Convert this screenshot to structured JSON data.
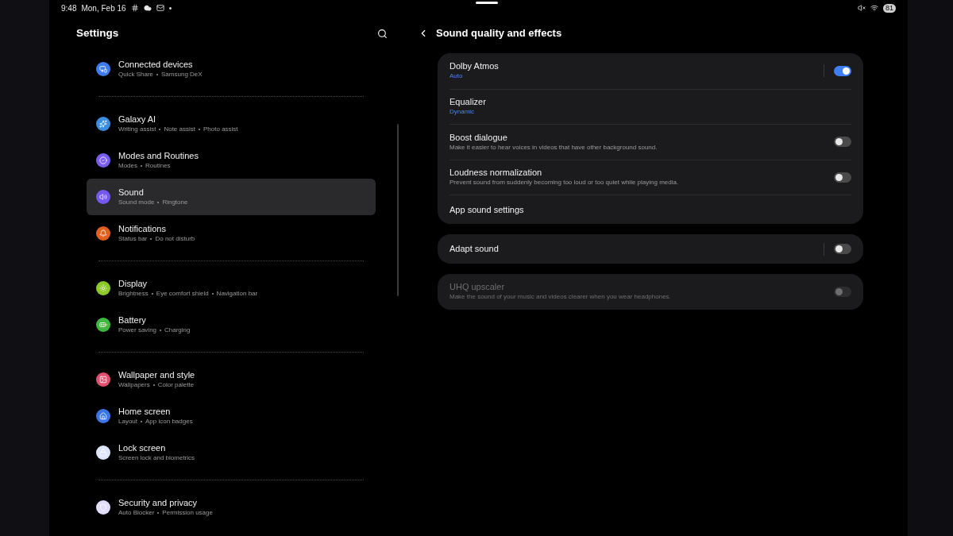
{
  "status_bar": {
    "time": "9:48",
    "date": "Mon, Feb 16",
    "dot": "•",
    "battery": "81"
  },
  "sidebar": {
    "title": "Settings",
    "groups": [
      [
        {
          "title": "Connected devices",
          "details": [
            "Quick Share",
            "Samsung DeX"
          ],
          "color": "#3f7bf0",
          "selected": false
        }
      ],
      [
        {
          "title": "Galaxy AI",
          "details": [
            "Writing assist",
            "Note assist",
            "Photo assist"
          ],
          "color": "#3a8de0",
          "selected": false
        },
        {
          "title": "Modes and Routines",
          "details": [
            "Modes",
            "Routines"
          ],
          "color": "#7b5cf0",
          "selected": false
        },
        {
          "title": "Sound",
          "details": [
            "Sound mode",
            "Ringtone"
          ],
          "color": "#7559ee",
          "selected": true
        },
        {
          "title": "Notifications",
          "details": [
            "Status bar",
            "Do not disturb"
          ],
          "color": "#e2601f",
          "selected": false
        }
      ],
      [
        {
          "title": "Display",
          "details": [
            "Brightness",
            "Eye comfort shield",
            "Navigation bar"
          ],
          "color": "#8ac926",
          "selected": false
        },
        {
          "title": "Battery",
          "details": [
            "Power saving",
            "Charging"
          ],
          "color": "#3fb83f",
          "selected": false
        }
      ],
      [
        {
          "title": "Wallpaper and style",
          "details": [
            "Wallpapers",
            "Color palette"
          ],
          "color": "#e0506e",
          "selected": false
        },
        {
          "title": "Home screen",
          "details": [
            "Layout",
            "App icon badges"
          ],
          "color": "#3c74ea",
          "selected": false
        },
        {
          "title": "Lock screen",
          "details": [
            "Screen lock and biometrics"
          ],
          "color": "#dbe4fb",
          "selected": false
        }
      ],
      [
        {
          "title": "Security and privacy",
          "details": [
            "Auto Blocker",
            "Permission usage"
          ],
          "color": "#e2dcfb",
          "selected": false
        }
      ]
    ]
  },
  "detail": {
    "title": "Sound quality and effects",
    "cards": [
      {
        "disabled": false,
        "rows": [
          {
            "title": "Dolby Atmos",
            "value": "Auto",
            "toggle": {
              "on": true,
              "separated": true
            }
          },
          {
            "title": "Equalizer",
            "value": "Dynamic"
          },
          {
            "title": "Boost dialogue",
            "description": "Make it easier to hear voices in videos that have other background sound.",
            "toggle": {
              "on": false,
              "separated": false
            }
          },
          {
            "title": "Loudness normalization",
            "description": "Prevent sound from suddenly becoming too loud or too quiet while playing media.",
            "toggle": {
              "on": false,
              "separated": false
            }
          },
          {
            "title": "App sound settings"
          }
        ]
      },
      {
        "disabled": false,
        "rows": [
          {
            "title": "Adapt sound",
            "toggle": {
              "on": false,
              "separated": true
            }
          }
        ]
      },
      {
        "disabled": true,
        "rows": [
          {
            "title": "UHQ upscaler",
            "description": "Make the sound of your music and videos clearer when you wear headphones.",
            "toggle": {
              "on": false,
              "separated": false
            }
          }
        ]
      }
    ]
  }
}
